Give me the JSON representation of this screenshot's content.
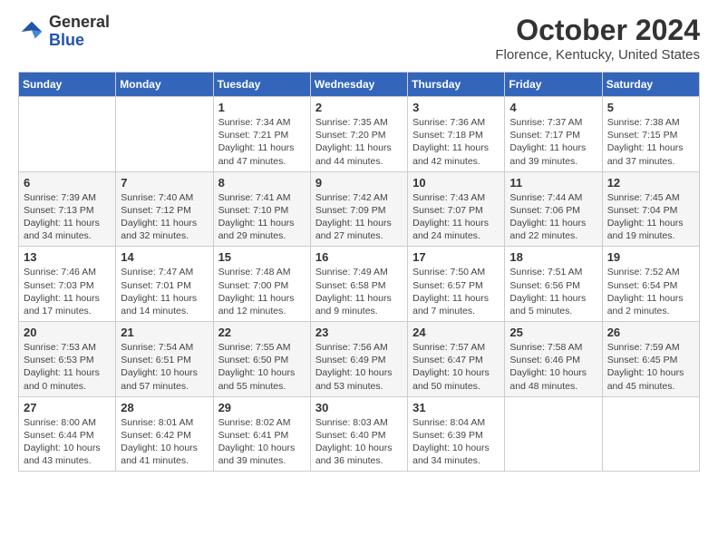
{
  "header": {
    "logo_general": "General",
    "logo_blue": "Blue",
    "month_title": "October 2024",
    "location": "Florence, Kentucky, United States"
  },
  "weekdays": [
    "Sunday",
    "Monday",
    "Tuesday",
    "Wednesday",
    "Thursday",
    "Friday",
    "Saturday"
  ],
  "weeks": [
    [
      null,
      null,
      {
        "day": 1,
        "sunrise": "Sunrise: 7:34 AM",
        "sunset": "Sunset: 7:21 PM",
        "daylight": "Daylight: 11 hours and 47 minutes."
      },
      {
        "day": 2,
        "sunrise": "Sunrise: 7:35 AM",
        "sunset": "Sunset: 7:20 PM",
        "daylight": "Daylight: 11 hours and 44 minutes."
      },
      {
        "day": 3,
        "sunrise": "Sunrise: 7:36 AM",
        "sunset": "Sunset: 7:18 PM",
        "daylight": "Daylight: 11 hours and 42 minutes."
      },
      {
        "day": 4,
        "sunrise": "Sunrise: 7:37 AM",
        "sunset": "Sunset: 7:17 PM",
        "daylight": "Daylight: 11 hours and 39 minutes."
      },
      {
        "day": 5,
        "sunrise": "Sunrise: 7:38 AM",
        "sunset": "Sunset: 7:15 PM",
        "daylight": "Daylight: 11 hours and 37 minutes."
      }
    ],
    [
      {
        "day": 6,
        "sunrise": "Sunrise: 7:39 AM",
        "sunset": "Sunset: 7:13 PM",
        "daylight": "Daylight: 11 hours and 34 minutes."
      },
      {
        "day": 7,
        "sunrise": "Sunrise: 7:40 AM",
        "sunset": "Sunset: 7:12 PM",
        "daylight": "Daylight: 11 hours and 32 minutes."
      },
      {
        "day": 8,
        "sunrise": "Sunrise: 7:41 AM",
        "sunset": "Sunset: 7:10 PM",
        "daylight": "Daylight: 11 hours and 29 minutes."
      },
      {
        "day": 9,
        "sunrise": "Sunrise: 7:42 AM",
        "sunset": "Sunset: 7:09 PM",
        "daylight": "Daylight: 11 hours and 27 minutes."
      },
      {
        "day": 10,
        "sunrise": "Sunrise: 7:43 AM",
        "sunset": "Sunset: 7:07 PM",
        "daylight": "Daylight: 11 hours and 24 minutes."
      },
      {
        "day": 11,
        "sunrise": "Sunrise: 7:44 AM",
        "sunset": "Sunset: 7:06 PM",
        "daylight": "Daylight: 11 hours and 22 minutes."
      },
      {
        "day": 12,
        "sunrise": "Sunrise: 7:45 AM",
        "sunset": "Sunset: 7:04 PM",
        "daylight": "Daylight: 11 hours and 19 minutes."
      }
    ],
    [
      {
        "day": 13,
        "sunrise": "Sunrise: 7:46 AM",
        "sunset": "Sunset: 7:03 PM",
        "daylight": "Daylight: 11 hours and 17 minutes."
      },
      {
        "day": 14,
        "sunrise": "Sunrise: 7:47 AM",
        "sunset": "Sunset: 7:01 PM",
        "daylight": "Daylight: 11 hours and 14 minutes."
      },
      {
        "day": 15,
        "sunrise": "Sunrise: 7:48 AM",
        "sunset": "Sunset: 7:00 PM",
        "daylight": "Daylight: 11 hours and 12 minutes."
      },
      {
        "day": 16,
        "sunrise": "Sunrise: 7:49 AM",
        "sunset": "Sunset: 6:58 PM",
        "daylight": "Daylight: 11 hours and 9 minutes."
      },
      {
        "day": 17,
        "sunrise": "Sunrise: 7:50 AM",
        "sunset": "Sunset: 6:57 PM",
        "daylight": "Daylight: 11 hours and 7 minutes."
      },
      {
        "day": 18,
        "sunrise": "Sunrise: 7:51 AM",
        "sunset": "Sunset: 6:56 PM",
        "daylight": "Daylight: 11 hours and 5 minutes."
      },
      {
        "day": 19,
        "sunrise": "Sunrise: 7:52 AM",
        "sunset": "Sunset: 6:54 PM",
        "daylight": "Daylight: 11 hours and 2 minutes."
      }
    ],
    [
      {
        "day": 20,
        "sunrise": "Sunrise: 7:53 AM",
        "sunset": "Sunset: 6:53 PM",
        "daylight": "Daylight: 11 hours and 0 minutes."
      },
      {
        "day": 21,
        "sunrise": "Sunrise: 7:54 AM",
        "sunset": "Sunset: 6:51 PM",
        "daylight": "Daylight: 10 hours and 57 minutes."
      },
      {
        "day": 22,
        "sunrise": "Sunrise: 7:55 AM",
        "sunset": "Sunset: 6:50 PM",
        "daylight": "Daylight: 10 hours and 55 minutes."
      },
      {
        "day": 23,
        "sunrise": "Sunrise: 7:56 AM",
        "sunset": "Sunset: 6:49 PM",
        "daylight": "Daylight: 10 hours and 53 minutes."
      },
      {
        "day": 24,
        "sunrise": "Sunrise: 7:57 AM",
        "sunset": "Sunset: 6:47 PM",
        "daylight": "Daylight: 10 hours and 50 minutes."
      },
      {
        "day": 25,
        "sunrise": "Sunrise: 7:58 AM",
        "sunset": "Sunset: 6:46 PM",
        "daylight": "Daylight: 10 hours and 48 minutes."
      },
      {
        "day": 26,
        "sunrise": "Sunrise: 7:59 AM",
        "sunset": "Sunset: 6:45 PM",
        "daylight": "Daylight: 10 hours and 45 minutes."
      }
    ],
    [
      {
        "day": 27,
        "sunrise": "Sunrise: 8:00 AM",
        "sunset": "Sunset: 6:44 PM",
        "daylight": "Daylight: 10 hours and 43 minutes."
      },
      {
        "day": 28,
        "sunrise": "Sunrise: 8:01 AM",
        "sunset": "Sunset: 6:42 PM",
        "daylight": "Daylight: 10 hours and 41 minutes."
      },
      {
        "day": 29,
        "sunrise": "Sunrise: 8:02 AM",
        "sunset": "Sunset: 6:41 PM",
        "daylight": "Daylight: 10 hours and 39 minutes."
      },
      {
        "day": 30,
        "sunrise": "Sunrise: 8:03 AM",
        "sunset": "Sunset: 6:40 PM",
        "daylight": "Daylight: 10 hours and 36 minutes."
      },
      {
        "day": 31,
        "sunrise": "Sunrise: 8:04 AM",
        "sunset": "Sunset: 6:39 PM",
        "daylight": "Daylight: 10 hours and 34 minutes."
      },
      null,
      null
    ]
  ]
}
